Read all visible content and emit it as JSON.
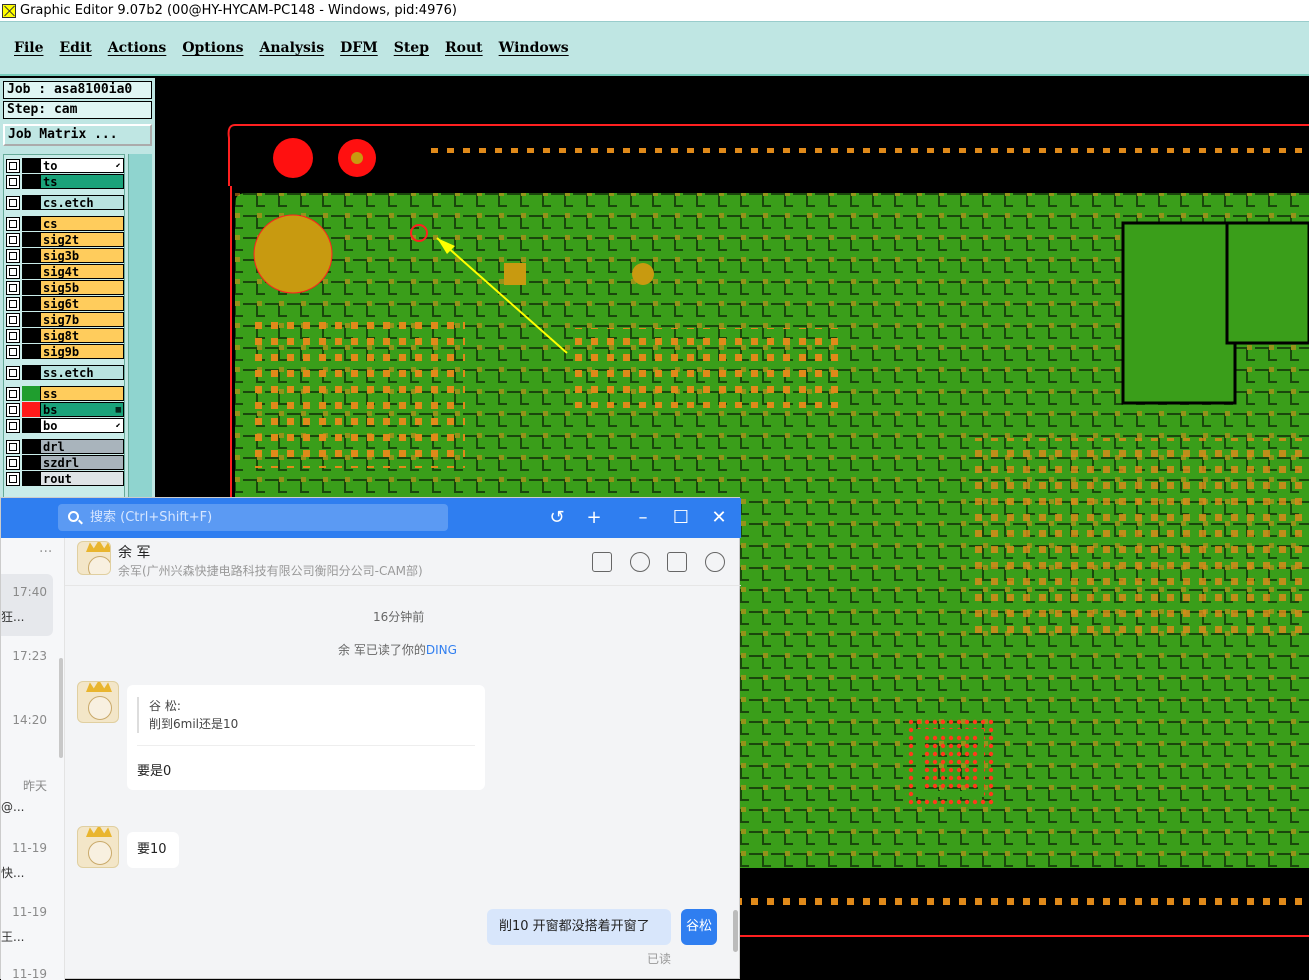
{
  "titlebar": {
    "title": "Graphic Editor 9.07b2 (00@HY-HYCAM-PC148 - Windows, pid:4976)"
  },
  "menu": [
    "File",
    "Edit",
    "Actions",
    "Options",
    "Analysis",
    "DFM",
    "Step",
    "Rout",
    "Windows"
  ],
  "panel": {
    "job": "Job : asa8100ia0",
    "step": "Step: cam",
    "job_matrix": "Job Matrix ..."
  },
  "layers": [
    {
      "name": "to",
      "color": "#000000",
      "bg": "#ffffff",
      "mark": "⬋"
    },
    {
      "name": "ts",
      "color": "#000000",
      "bg": "#1aa37a",
      "mark": ""
    },
    {
      "name": "cs.etch",
      "color": "#000000",
      "bg": "#b9e3e0",
      "mark": ""
    },
    {
      "name": "cs",
      "color": "#000000",
      "bg": "#ffcc5c",
      "mark": ""
    },
    {
      "name": "sig2t",
      "color": "#000000",
      "bg": "#ffcc5c",
      "mark": ""
    },
    {
      "name": "sig3b",
      "color": "#000000",
      "bg": "#ffcc5c",
      "mark": ""
    },
    {
      "name": "sig4t",
      "color": "#000000",
      "bg": "#ffcc5c",
      "mark": ""
    },
    {
      "name": "sig5b",
      "color": "#000000",
      "bg": "#ffcc5c",
      "mark": ""
    },
    {
      "name": "sig6t",
      "color": "#000000",
      "bg": "#ffcc5c",
      "mark": ""
    },
    {
      "name": "sig7b",
      "color": "#000000",
      "bg": "#ffcc5c",
      "mark": ""
    },
    {
      "name": "sig8t",
      "color": "#000000",
      "bg": "#ffcc5c",
      "mark": ""
    },
    {
      "name": "sig9b",
      "color": "#000000",
      "bg": "#ffcc5c",
      "mark": ""
    },
    {
      "name": "ss.etch",
      "color": "#000000",
      "bg": "#b9e3e0",
      "mark": ""
    },
    {
      "name": "ss",
      "color": "#1f9e2e",
      "bg": "#ffcc5c",
      "mark": ""
    },
    {
      "name": "bs",
      "color": "#ff1a1a",
      "bg": "#1aa37a",
      "mark": "▦"
    },
    {
      "name": "bo",
      "color": "#000000",
      "bg": "#ffffff",
      "mark": "⬋"
    },
    {
      "name": "drl",
      "color": "#000000",
      "bg": "#a9b4bc",
      "mark": ""
    },
    {
      "name": "szdrl",
      "color": "#000000",
      "bg": "#a9b4bc",
      "mark": ""
    },
    {
      "name": "rout",
      "color": "#000000",
      "bg": "#dfe3e6",
      "mark": ""
    }
  ],
  "chat": {
    "search_placeholder": "搜索 (Ctrl+Shift+F)",
    "contact_name": "余  军",
    "contact_org": "余军(广州兴森快捷电路科技有限公司衡阳分公司-CAM部)",
    "sidebar_times": [
      "17:40",
      "17:23",
      "14:20",
      "昨天",
      "11-19",
      "11-19",
      "11-19"
    ],
    "sidebar_snips": [
      "狂...",
      "",
      "",
      "@...",
      "快...",
      "王...",
      ""
    ],
    "time_divider": "16分钟前",
    "read_notice_prefix": "余  军已读了你的",
    "read_notice_link": "DING",
    "quote_name": "谷  松:",
    "quote_text": "削到6mil还是10",
    "reply1": "要是0",
    "reply2": "要10",
    "my_msg": "削10 开窗都没搭着开窗了",
    "my_avatar": "谷松",
    "read_status": "已读"
  }
}
